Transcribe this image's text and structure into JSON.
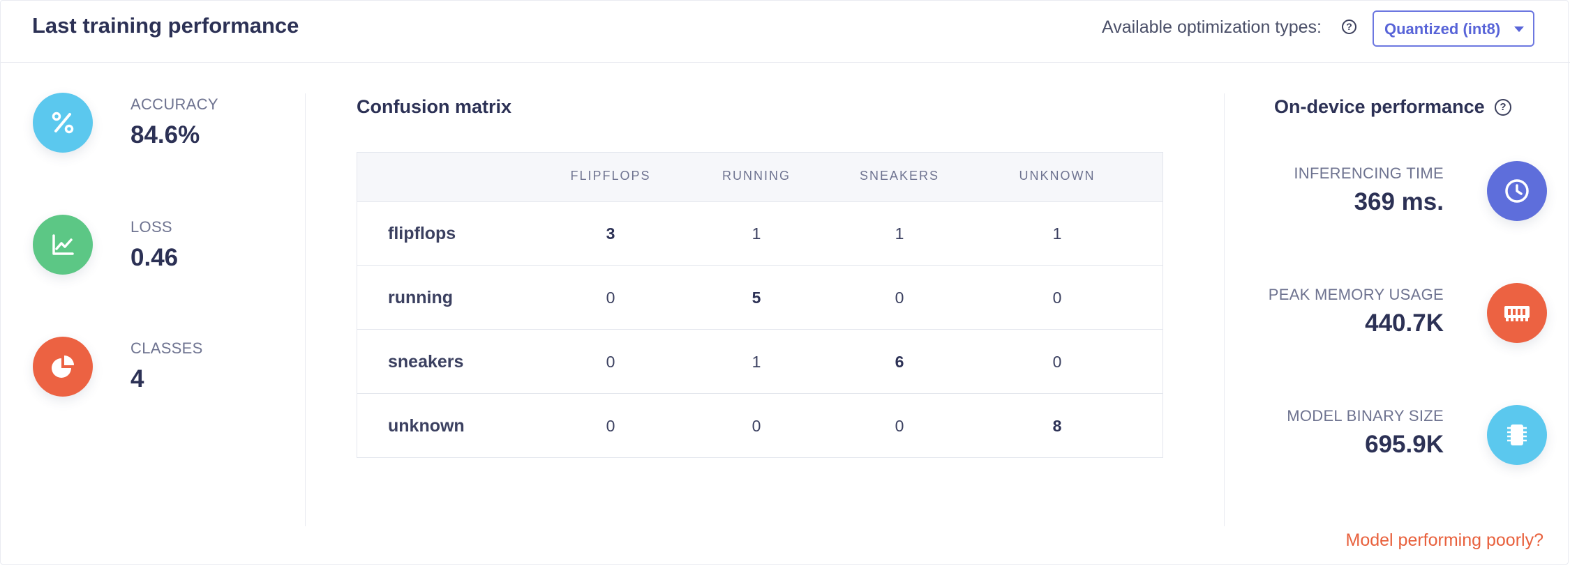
{
  "header": {
    "title": "Last training performance",
    "optimization_label": "Available optimization types:",
    "optimization_selected": "Quantized (int8)"
  },
  "metrics": [
    {
      "label": "ACCURACY",
      "value": "84.6%",
      "icon": "percent-icon",
      "color": "#5bc8ee"
    },
    {
      "label": "LOSS",
      "value": "0.46",
      "icon": "chart-line-icon",
      "color": "#5cc785"
    },
    {
      "label": "CLASSES",
      "value": "4",
      "icon": "pie-chart-icon",
      "color": "#ec6242"
    }
  ],
  "confusion_matrix": {
    "title": "Confusion matrix",
    "columns": [
      "FLIPFLOPS",
      "RUNNING",
      "SNEAKERS",
      "UNKNOWN"
    ],
    "rows": [
      {
        "label": "flipflops",
        "values": [
          "3",
          "1",
          "1",
          "1"
        ]
      },
      {
        "label": "running",
        "values": [
          "0",
          "5",
          "0",
          "0"
        ]
      },
      {
        "label": "sneakers",
        "values": [
          "0",
          "1",
          "6",
          "0"
        ]
      },
      {
        "label": "unknown",
        "values": [
          "0",
          "0",
          "0",
          "8"
        ]
      }
    ]
  },
  "on_device": {
    "title": "On-device performance",
    "items": [
      {
        "label": "INFERENCING TIME",
        "value": "369 ms.",
        "icon": "clock-icon",
        "color": "#5e6edb"
      },
      {
        "label": "PEAK MEMORY USAGE",
        "value": "440.7K",
        "icon": "memory-icon",
        "color": "#ec6242"
      },
      {
        "label": "MODEL BINARY SIZE",
        "value": "695.9K",
        "icon": "chip-icon",
        "color": "#5bc8ee"
      }
    ]
  },
  "footer": {
    "link": "Model performing poorly?",
    "link_color": "#e8603c"
  }
}
